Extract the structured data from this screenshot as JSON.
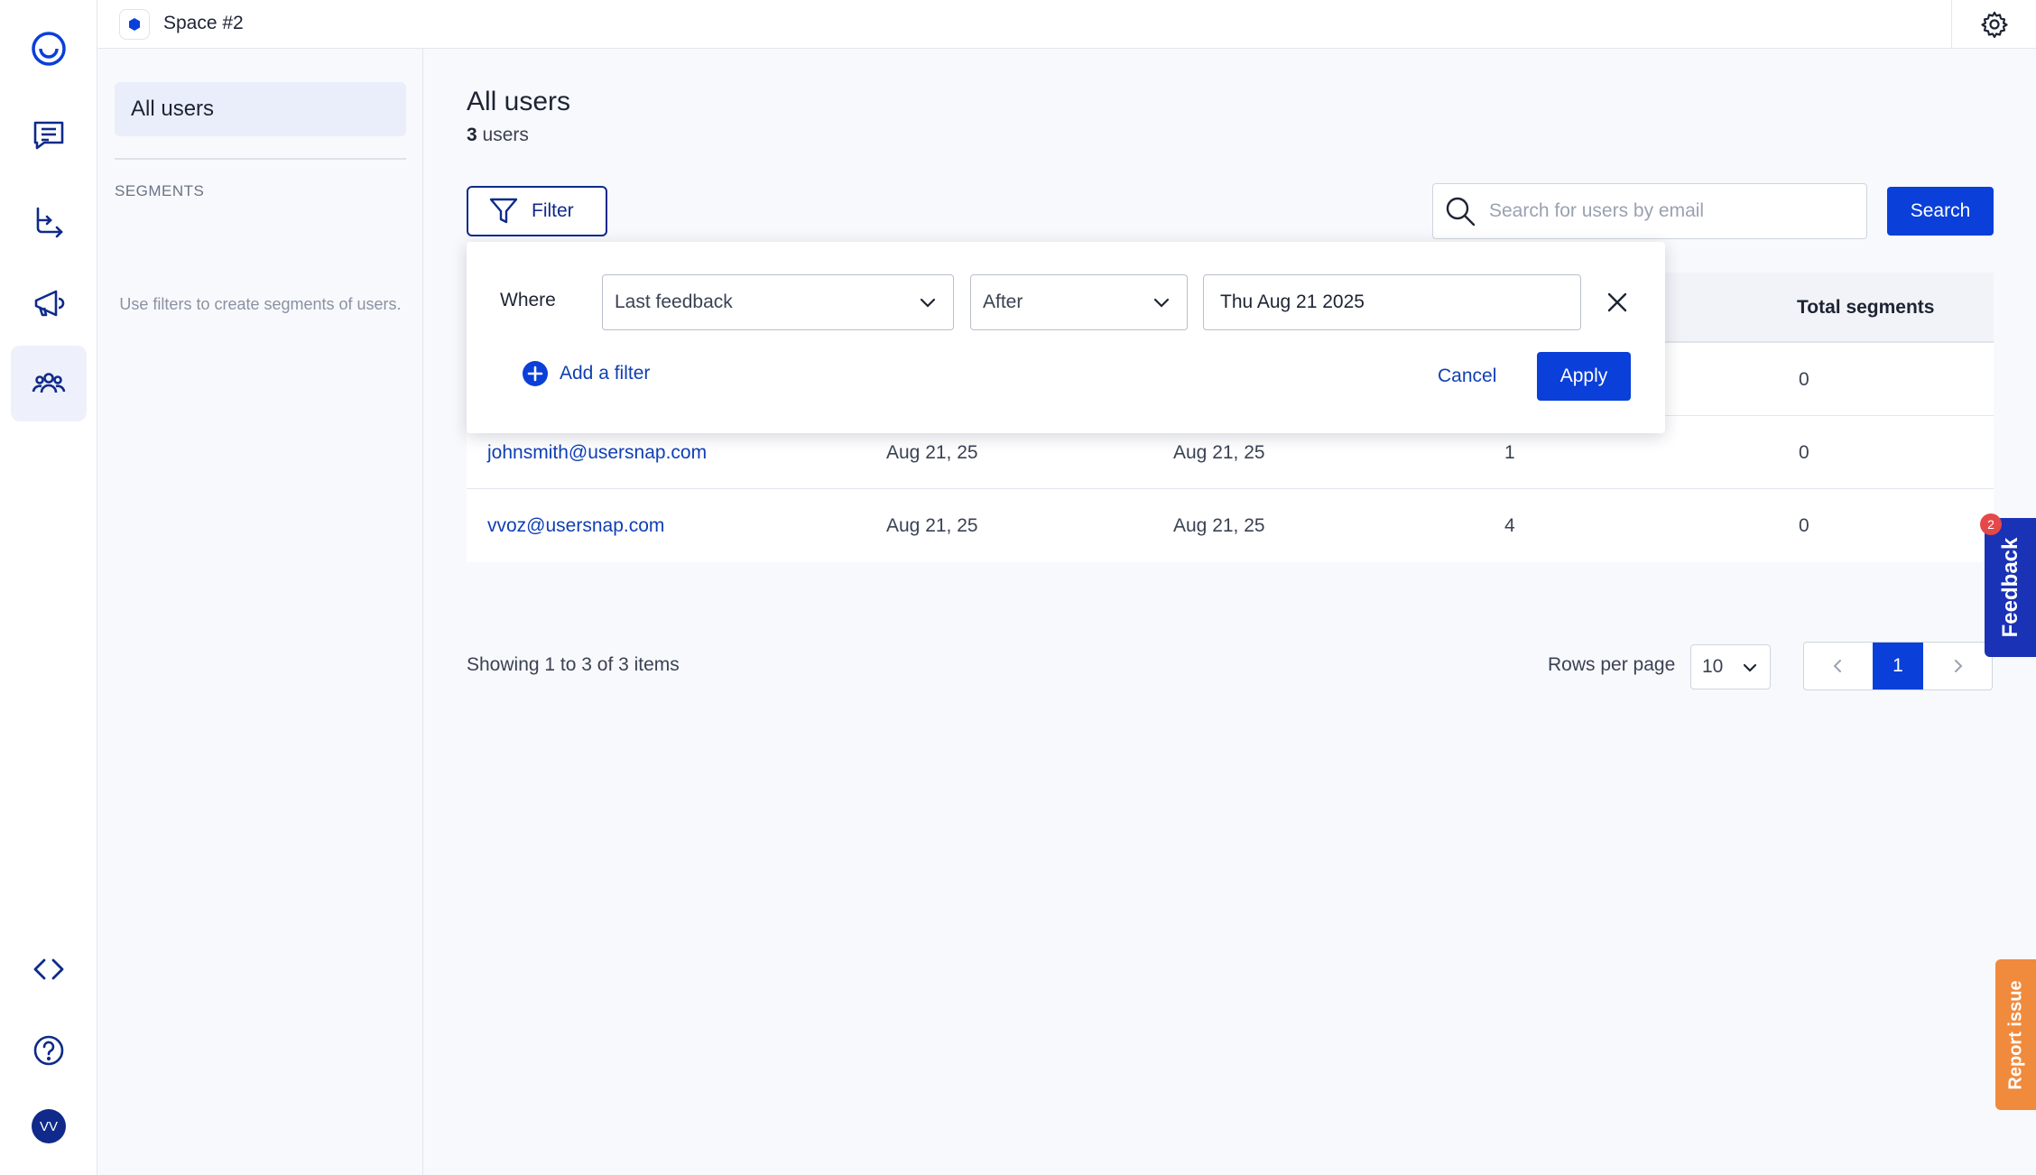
{
  "topbar": {
    "space_name": "Space #2"
  },
  "rail": {
    "avatar_initials": "VV",
    "icons": [
      "logo-icon",
      "feedback-list-icon",
      "routing-icon",
      "megaphone-icon",
      "users-icon",
      "code-icon",
      "help-icon"
    ]
  },
  "sidebar": {
    "all_users_label": "All users",
    "segments_heading": "SEGMENTS",
    "segments_empty": "Use filters to create segments of users."
  },
  "main": {
    "title": "All users",
    "user_count": "3",
    "user_count_suffix": " users",
    "filter_label": "Filter",
    "search_placeholder": "Search for users by email",
    "search_label": "Search"
  },
  "table": {
    "visible_header": "Total segments",
    "rows": [
      {
        "email": "",
        "first_seen": "",
        "last_feedback": "",
        "feedback": "",
        "segments": "0"
      },
      {
        "email": "johnsmith@usersnap.com",
        "first_seen": "Aug 21, 25",
        "last_feedback": "Aug 21, 25",
        "feedback": "1",
        "segments": "0"
      },
      {
        "email": "vvoz@usersnap.com",
        "first_seen": "Aug 21, 25",
        "last_feedback": "Aug 21, 25",
        "feedback": "4",
        "segments": "0"
      }
    ]
  },
  "filter_popover": {
    "where_label": "Where",
    "field_value": "Last feedback",
    "operator_value": "After",
    "date_value": "Thu Aug 21 2025",
    "add_filter_label": "Add a filter",
    "cancel_label": "Cancel",
    "apply_label": "Apply"
  },
  "pagination": {
    "showing_text": "Showing 1 to 3 of 3 items",
    "rows_per_page_label": "Rows per page",
    "rows_per_page_value": "10",
    "current_page": "1"
  },
  "widgets": {
    "feedback_label": "Feedback",
    "feedback_badge": "2",
    "report_label": "Report issue"
  },
  "colors": {
    "primary": "#0a3fd9",
    "navy": "#0f2a8a",
    "feedback_tab": "#1a32b5",
    "report_tab": "#f08a3c"
  }
}
